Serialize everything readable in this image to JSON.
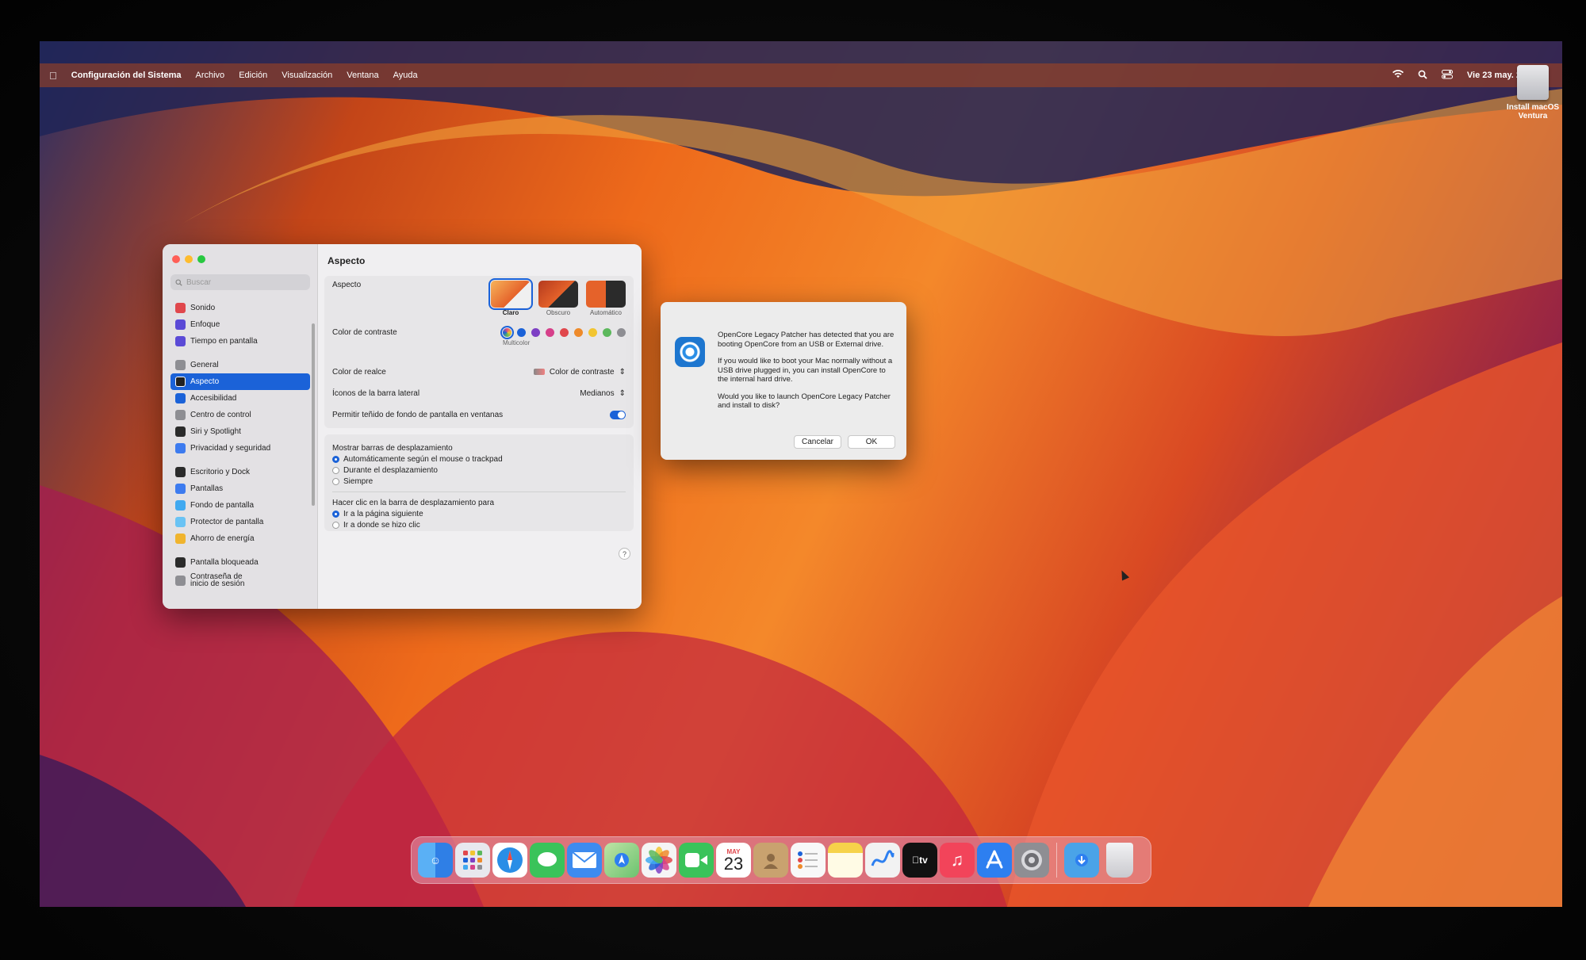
{
  "menubar": {
    "app_name": "Configuración del Sistema",
    "menus": [
      "Archivo",
      "Edición",
      "Visualización",
      "Ventana",
      "Ayuda"
    ],
    "clock": "Vie 23 may.  21:20"
  },
  "desktop": {
    "drive_label": "Install macOS Ventura"
  },
  "settings": {
    "search_placeholder": "Buscar",
    "sidebar": [
      {
        "label": "Sonido",
        "icon": "sound-icon",
        "color": "#e0474c"
      },
      {
        "label": "Enfoque",
        "icon": "focus-icon",
        "color": "#5b4ad6"
      },
      {
        "label": "Tiempo en pantalla",
        "icon": "screen-time-icon",
        "color": "#5b4ad6"
      },
      {
        "label": "General",
        "icon": "general-icon",
        "color": "#8e8e93"
      },
      {
        "label": "Aspecto",
        "icon": "appearance-icon",
        "color": "#222222",
        "selected": true
      },
      {
        "label": "Accesibilidad",
        "icon": "accessibility-icon",
        "color": "#1b62d8"
      },
      {
        "label": "Centro de control",
        "icon": "control-center-icon",
        "color": "#8e8e93"
      },
      {
        "label": "Siri y Spotlight",
        "icon": "siri-icon",
        "color": "#2b2b2b"
      },
      {
        "label": "Privacidad y seguridad",
        "icon": "privacy-icon",
        "color": "#3d7bef"
      },
      {
        "label": "Escritorio y Dock",
        "icon": "desktop-dock-icon",
        "color": "#2b2b2b"
      },
      {
        "label": "Pantallas",
        "icon": "displays-icon",
        "color": "#3d7bef"
      },
      {
        "label": "Fondo de pantalla",
        "icon": "wallpaper-icon",
        "color": "#40a9f0"
      },
      {
        "label": "Protector de pantalla",
        "icon": "screensaver-icon",
        "color": "#6ac3f4"
      },
      {
        "label": "Ahorro de energía",
        "icon": "energy-icon",
        "color": "#f0b42e"
      },
      {
        "label": "Pantalla bloqueada",
        "icon": "lock-screen-icon",
        "color": "#2b2b2b"
      },
      {
        "label": "Contraseña de inicio de sesión",
        "icon": "login-password-icon",
        "color": "#8e8e93"
      }
    ],
    "title": "Aspecto",
    "aspect_label": "Aspecto",
    "themes": [
      {
        "label": "Claro",
        "selected": true
      },
      {
        "label": "Obscuro",
        "selected": false
      },
      {
        "label": "Automático",
        "selected": false
      }
    ],
    "contrast_label": "Color de contraste",
    "contrast_selected": "Multicolor",
    "contrast_colors": [
      "#e94e77",
      "#1b62d8",
      "#7d3fc4",
      "#d6408a",
      "#e0474c",
      "#ee8a2a",
      "#f2c531",
      "#5cb85c",
      "#8e8e93"
    ],
    "highlight_label": "Color de realce",
    "highlight_value": "Color de contraste",
    "sidebar_icons_label": "Íconos de la barra lateral",
    "sidebar_icons_value": "Medianos",
    "tint_label": "Permitir teñido de fondo de pantalla en ventanas",
    "tint_on": true,
    "scroll_title": "Mostrar barras de desplazamiento",
    "scroll_options": [
      {
        "label": "Automáticamente según el mouse o trackpad",
        "selected": true
      },
      {
        "label": "Durante el desplazamiento",
        "selected": false
      },
      {
        "label": "Siempre",
        "selected": false
      }
    ],
    "click_title": "Hacer clic en la barra de desplazamiento para",
    "click_options": [
      {
        "label": "Ir a la página siguiente",
        "selected": true
      },
      {
        "label": "Ir a donde se hizo clic",
        "selected": false
      }
    ],
    "help": "?"
  },
  "dialog": {
    "p1": "OpenCore Legacy Patcher has detected that you are booting OpenCore from an USB or External drive.",
    "p2": "If you would like to boot your Mac normally without a USB drive plugged in, you can install OpenCore to the internal hard drive.",
    "p3": "Would you like to launch OpenCore Legacy Patcher and install to disk?",
    "cancel": "Cancelar",
    "ok": "OK"
  },
  "dock": {
    "calendar_month": "MAY",
    "calendar_day": "23",
    "apps": [
      {
        "name": "finder-icon",
        "color": "#2f7fe6"
      },
      {
        "name": "launchpad-icon",
        "color": "#e8e8ee"
      },
      {
        "name": "safari-icon",
        "color": "#2a8ee6"
      },
      {
        "name": "messages-icon",
        "color": "#3ac35a"
      },
      {
        "name": "mail-icon",
        "color": "#3d8bef"
      },
      {
        "name": "maps-icon",
        "color": "#6bc36f"
      },
      {
        "name": "photos-icon",
        "color": "#f5f5f5"
      },
      {
        "name": "facetime-icon",
        "color": "#3ac35a"
      },
      {
        "name": "calendar-icon",
        "color": "#ffffff"
      },
      {
        "name": "contacts-icon",
        "color": "#c9a26f"
      },
      {
        "name": "reminders-icon",
        "color": "#f8f8f8"
      },
      {
        "name": "notes-icon",
        "color": "#f6d24a"
      },
      {
        "name": "freeform-icon",
        "color": "#f2f2f2"
      },
      {
        "name": "appletv-icon",
        "color": "#111111"
      },
      {
        "name": "music-icon",
        "color": "#f2445a"
      },
      {
        "name": "appstore-icon",
        "color": "#2d7ff0"
      },
      {
        "name": "system-settings-icon",
        "color": "#8e8e93"
      }
    ],
    "downloads_color": "#4aa3e8",
    "trash_color": "#d9d9dd"
  }
}
